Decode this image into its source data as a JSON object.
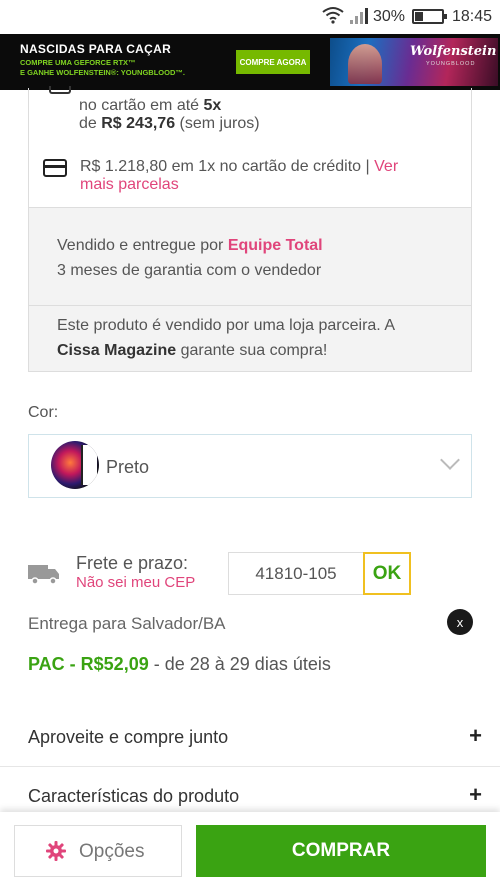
{
  "status_bar": {
    "battery": "30%",
    "time": "18:45"
  },
  "ad": {
    "title": "NASCIDAS PARA CAÇAR",
    "line1": "COMPRE UMA GEFORCE RTX™",
    "line2": "E GANHE WOLFENSTEIN®: YOUNGBLOOD™.",
    "cta": "COMPRE AGORA",
    "brand": "Wolfenstein",
    "brand_sub": "YOUNGBLOOD"
  },
  "payment": {
    "installment_prefix": "no cartão em até",
    "installment_count": "5x",
    "installment_de": "de",
    "installment_value": "R$ 243,76",
    "installment_suffix": "(sem juros)",
    "single_text": "R$ 1.218,80 em 1x no cartão de crédito |",
    "more_link_1": "Ver",
    "more_link_2": "mais parcelas"
  },
  "seller": {
    "line1_prefix": "Vendido e entregue por",
    "name": "Equipe Total",
    "warranty": "3 meses de garantia com o vendedor"
  },
  "partner": {
    "line1": "Este produto é vendido por uma loja parceira. A",
    "store": "Cissa Magazine",
    "line2_suffix": "garante sua compra!"
  },
  "color": {
    "label": "Cor:",
    "selected": "Preto"
  },
  "freight": {
    "label": "Frete e prazo:",
    "cep_link": "Não sei meu CEP",
    "cep_value": "41810-105",
    "ok_label": "OK",
    "delivery_to": "Entrega para Salvador/BA",
    "close_label": "x",
    "option": "PAC - R$52,09",
    "option_detail": "- de 28 à  29 dias úteis"
  },
  "accordion": [
    {
      "label": "Aproveite e compre junto",
      "icon": "+"
    },
    {
      "label": "Características do produto",
      "icon": "+"
    }
  ],
  "bottom_bar": {
    "options_label": "Opções",
    "buy_label": "COMPRAR"
  },
  "colors": {
    "accent_pink": "#e0457b",
    "green": "#3aa312",
    "ok_border": "#f0c020"
  }
}
